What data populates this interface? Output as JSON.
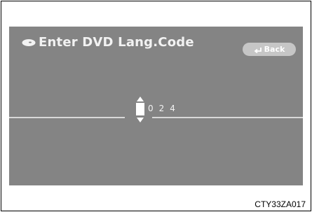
{
  "screen": {
    "title": "Enter DVD  Lang.Code",
    "title_icon": "disc-icon",
    "back_button": {
      "label": "Back",
      "icon": "return-arrow-icon"
    },
    "code_entry": {
      "current_digit": "",
      "digits": [
        "0",
        "2",
        "4"
      ]
    }
  },
  "figure_code": "CTY33ZA017",
  "colors": {
    "screen_background": "#848484",
    "text": "#f2f2f2",
    "button": "#c6c6c6"
  }
}
